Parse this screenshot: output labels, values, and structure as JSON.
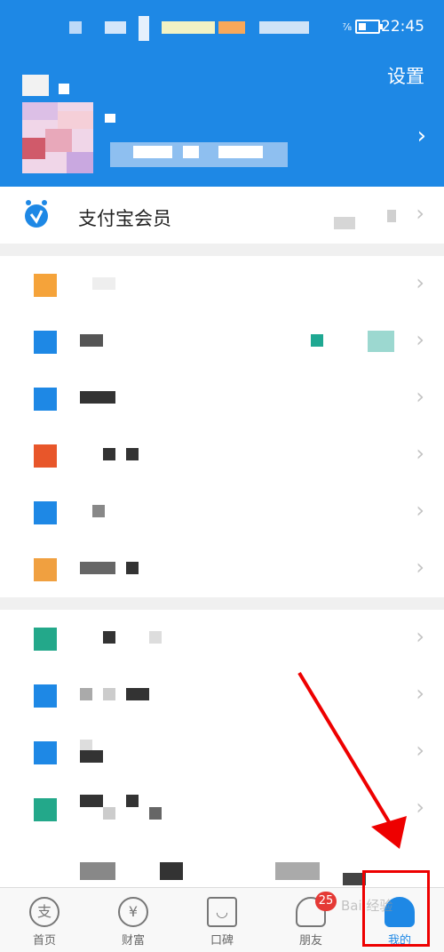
{
  "status": {
    "time": "22:45"
  },
  "header": {
    "settings_label": "设置"
  },
  "member": {
    "label": "支付宝会员"
  },
  "tabs": [
    {
      "icon": "支",
      "label": "首页"
    },
    {
      "icon": "¥",
      "label": "财富"
    },
    {
      "icon": "◡",
      "label": "口碑"
    },
    {
      "icon": "",
      "label": "朋友",
      "badge": "25"
    },
    {
      "icon": "",
      "label": "我的"
    }
  ],
  "watermark": "Bai 经验",
  "colors": {
    "primary": "#1e88e5",
    "annotation": "#ee0000"
  }
}
